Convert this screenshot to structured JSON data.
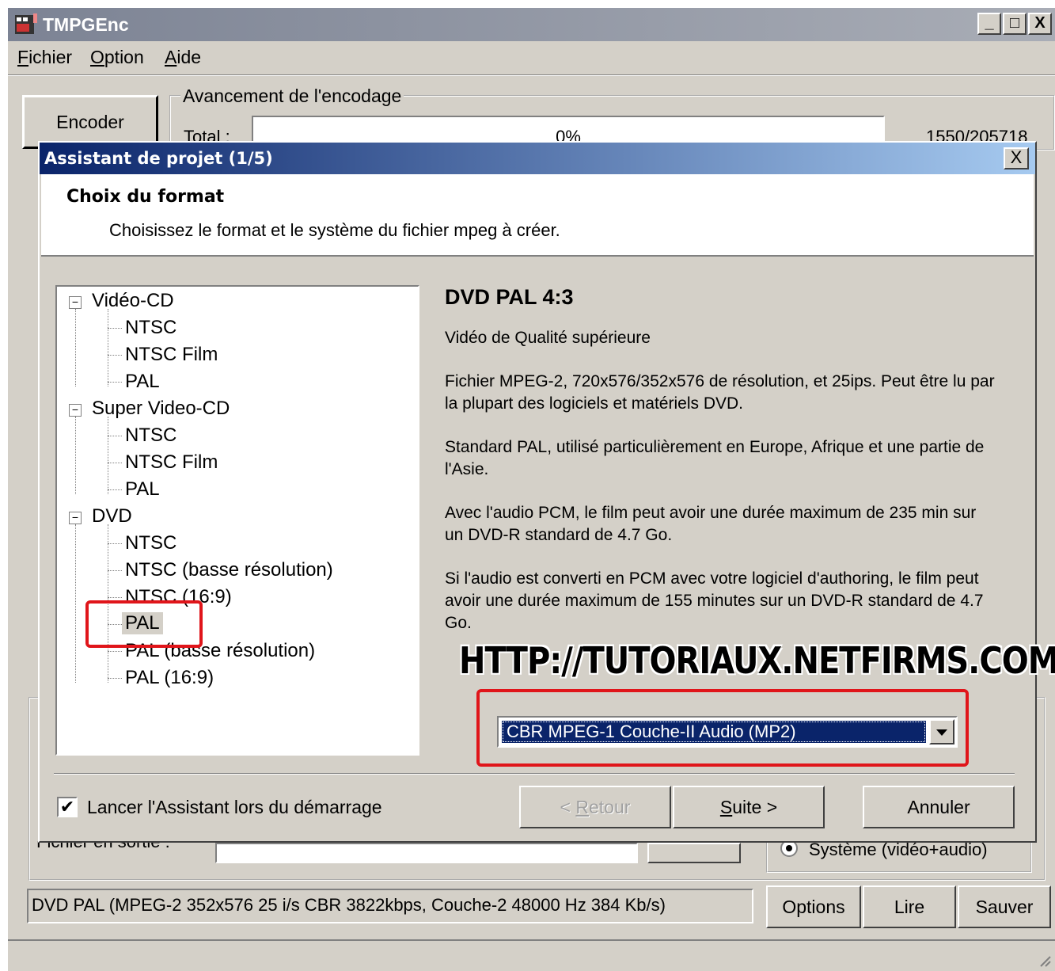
{
  "app": {
    "title": "TMPGEnc",
    "window_buttons": [
      "_",
      "□",
      "X"
    ]
  },
  "menu": [
    {
      "label": "Fichier",
      "underline": "F",
      "rest": "ichier"
    },
    {
      "label": "Option",
      "underline": "O",
      "rest": "ption"
    },
    {
      "label": "Aide",
      "underline": "A",
      "rest": "ide"
    }
  ],
  "main": {
    "encode_button": "Encoder",
    "progress_group_label": "Avancement de l'encodage",
    "total_label": "Total :",
    "progress_percent": "0%",
    "progress_fraction": 0,
    "frame_counter": "1550/205718",
    "output_file_label": "Fichier en sortie :",
    "system_radio_label": "Système (vidéo+audio)",
    "status_text": "DVD PAL (MPEG-2 352x576 25 i/s CBR 3822kbps,  Couche-2 48000 Hz 384 Kb/s)",
    "options_button": "Options",
    "play_button": "Lire",
    "save_button": "Sauver"
  },
  "dialog": {
    "title": "Assistant de projet (1/5)",
    "close": "X",
    "header_title": "Choix du format",
    "header_subtitle": "Choisissez le format et le système du fichier mpeg à créer.",
    "tree": {
      "vcd": "Vidéo-CD",
      "vcd_ntsc": "NTSC",
      "vcd_ntsc_film": "NTSC Film",
      "vcd_pal": "PAL",
      "svcd": "Super Video-CD",
      "svcd_ntsc": "NTSC",
      "svcd_ntsc_film": "NTSC Film",
      "svcd_pal": "PAL",
      "dvd": "DVD",
      "dvd_ntsc": "NTSC",
      "dvd_ntsc_low": "NTSC (basse résolution)",
      "dvd_ntsc_169": "NTSC (16:9)",
      "dvd_pal": "PAL",
      "dvd_pal_low": "PAL (basse résolution)",
      "dvd_pal_169": "PAL (16:9)"
    },
    "description": {
      "title": "DVD PAL 4:3",
      "p1": "Vidéo de Qualité supérieure",
      "p2": "Fichier MPEG-2, 720x576/352x576 de résolution, et 25ips. Peut être lu par la plupart des logiciels et matériels DVD.",
      "p3": "Standard PAL, utilisé particulièrement en Europe, Afrique et une partie de l'Asie.",
      "p4": "Avec l'audio PCM, le film peut avoir une durée maximum de 235 min sur un DVD-R standard de 4.7 Go.",
      "p5": "Si l'audio est converti en PCM avec votre logiciel d'authoring, le film peut avoir une durée maximum de 155 minutes sur un DVD-R standard de 4.7 Go."
    },
    "watermark": "HTTP://TUTORIAUX.NETFIRMS.COM",
    "audio_select": "CBR  MPEG-1 Couche-II Audio (MP2)",
    "startup_checkbox_label": "Lancer l'Assistant lors du démarrage",
    "startup_checked": true,
    "back_button": "< Retour",
    "back_underline": "R",
    "next_button": "Suite >",
    "next_underline": "S",
    "cancel_button": "Annuler"
  },
  "colors": {
    "dialog_title_start": "#0a246a",
    "dialog_title_end": "#a6caf0",
    "highlight": "#e0151a",
    "face": "#d4d0c8",
    "selection": "#0a246a"
  }
}
